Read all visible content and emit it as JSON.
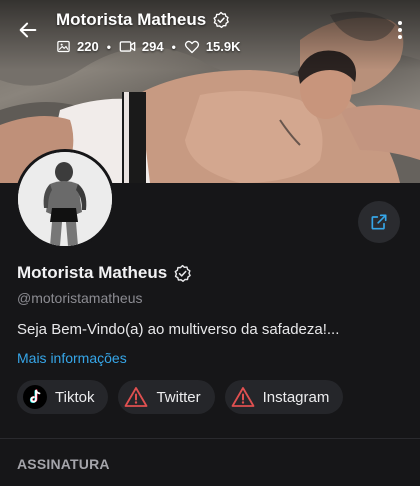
{
  "header": {
    "title": "Motorista Matheus",
    "stats": {
      "photos": "220",
      "videos": "294",
      "likes": "15.9K"
    }
  },
  "profile": {
    "name": "Motorista Matheus",
    "handle": "@motoristamatheus",
    "bio": "Seja Bem-Vindo(a) ao multiverso da safadeza!...",
    "more_info_label": "Mais informações"
  },
  "socials": [
    {
      "label": "Tiktok",
      "icon": "tiktok-icon"
    },
    {
      "label": "Twitter",
      "icon": "warning-icon"
    },
    {
      "label": "Instagram",
      "icon": "warning-icon"
    }
  ],
  "section": {
    "title": "ASSINATURA"
  },
  "colors": {
    "background": "#161618",
    "link": "#36a6e8",
    "chip_bg": "#25262a",
    "warning": "#e05050",
    "share_icon": "#36a6e8"
  }
}
